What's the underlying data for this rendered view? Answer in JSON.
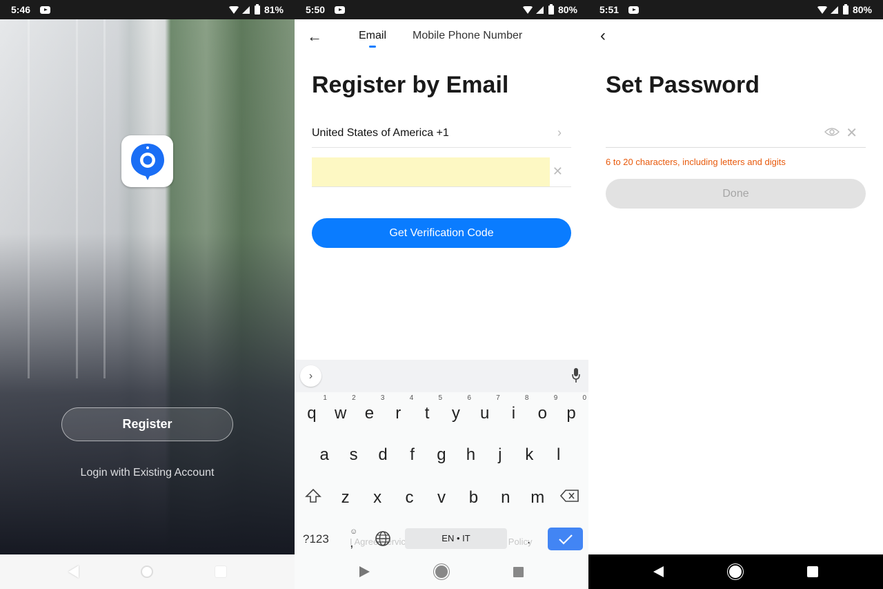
{
  "screens": [
    {
      "status": {
        "time": "5:46",
        "battery": "81%"
      },
      "app_icon": "camera-pin-logo",
      "register_label": "Register",
      "login_label": "Login with Existing Account",
      "accent": "#1a6ef5"
    },
    {
      "status": {
        "time": "5:50",
        "battery": "80%"
      },
      "tabs": [
        {
          "label": "Email",
          "active": true
        },
        {
          "label": "Mobile Phone Number",
          "active": false
        }
      ],
      "title": "Register by Email",
      "country": "United States of America +1",
      "email_value": "",
      "verify_label": "Get Verification Code",
      "accent": "#0a7cff",
      "keyboard": {
        "row1": [
          "q",
          "w",
          "e",
          "r",
          "t",
          "y",
          "u",
          "i",
          "o",
          "p"
        ],
        "row1_hints": [
          "1",
          "2",
          "3",
          "4",
          "5",
          "6",
          "7",
          "8",
          "9",
          "0"
        ],
        "row2": [
          "a",
          "s",
          "d",
          "f",
          "g",
          "h",
          "j",
          "k",
          "l"
        ],
        "row3": [
          "z",
          "x",
          "c",
          "v",
          "b",
          "n",
          "m"
        ],
        "symbols_label": "?123",
        "comma": ",",
        "period": ".",
        "space_label": "EN • IT",
        "emoji": "☺"
      },
      "agreement_ghost": "I Agree Service Agreement and Privacy Policy"
    },
    {
      "status": {
        "time": "5:51",
        "battery": "80%"
      },
      "title": "Set Password",
      "password_value": "",
      "hint": "6 to 20 characters, including letters and digits",
      "hint_color": "#e85a0c",
      "done_label": "Done"
    }
  ]
}
